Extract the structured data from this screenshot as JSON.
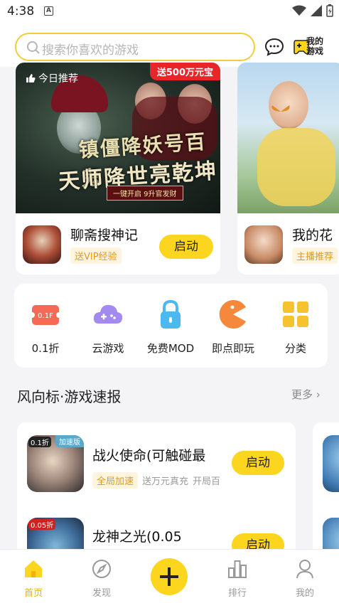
{
  "status_bar": {
    "time": "4:38",
    "sim_icon": "A"
  },
  "search": {
    "placeholder": "搜索你喜欢的游戏"
  },
  "header": {
    "my_games_label_line1": "我的",
    "my_games_label_line2": "游戏"
  },
  "banners": [
    {
      "tag": "今日推荐",
      "promo": "送500万元宝",
      "art_title_line1": "镇僵降妖号百鬼",
      "art_title_line2": "天师降世亮乾坤",
      "art_subtitle": "一键开启 9升官发财",
      "game_name": "聊斋搜神记",
      "game_tag": "送VIP经验",
      "button": "启动"
    },
    {
      "game_name": "我的花",
      "game_tag": "主播推荐"
    }
  ],
  "quick_entries": [
    {
      "label": "0.1折",
      "icon": "ticket-icon"
    },
    {
      "label": "云游戏",
      "icon": "cloud-gamepad-icon"
    },
    {
      "label": "免费MOD",
      "icon": "lock-icon"
    },
    {
      "label": "即点即玩",
      "icon": "pacman-icon"
    },
    {
      "label": "分类",
      "icon": "grid-icon"
    }
  ],
  "section": {
    "title": "风向标·游戏速报",
    "more": "更多"
  },
  "news": [
    {
      "name": "战火使命(可触碰最",
      "tags": [
        "全局加速",
        "送万元真充",
        "开局百"
      ],
      "ribbon": "加速版",
      "icon_badge": "0.1折",
      "button": "启动"
    },
    {
      "name": "龙神之光(0.05",
      "icon_badge": "0.05折",
      "button": "启动"
    }
  ],
  "tabs": [
    {
      "label": "首页",
      "active": true,
      "icon": "home-icon"
    },
    {
      "label": "发现",
      "active": false,
      "icon": "compass-icon"
    },
    {
      "label": "排行",
      "active": false,
      "icon": "ranking-icon"
    },
    {
      "label": "我的",
      "active": false,
      "icon": "profile-icon"
    }
  ],
  "colors": {
    "accent": "#fcd51e",
    "search_border": "#f3cc3a",
    "promo_red": "#e8262a",
    "tag_orange": "#e09a23"
  }
}
